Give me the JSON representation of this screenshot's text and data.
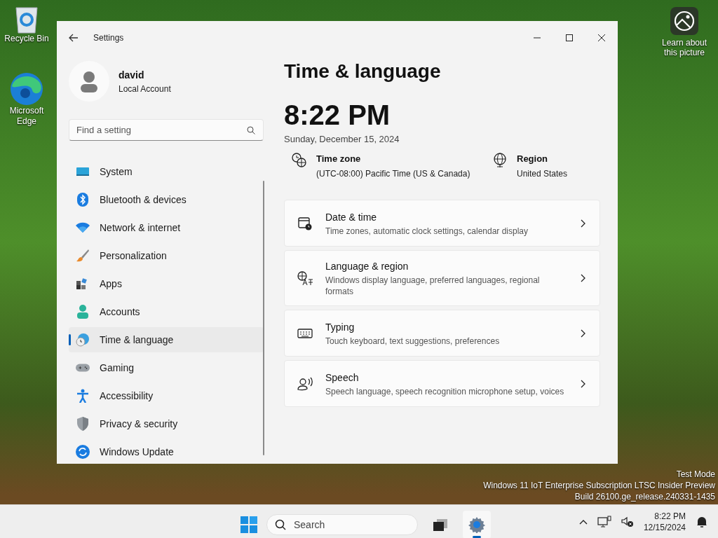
{
  "desktop": {
    "icons": [
      {
        "label": "Recycle Bin"
      },
      {
        "label": "Microsoft Edge"
      }
    ],
    "spotlight": {
      "label": "Learn about this picture"
    },
    "watermark": [
      "Test Mode",
      "Windows 11 IoT Enterprise Subscription LTSC Insider Preview",
      "Build 26100.ge_release.240331-1435"
    ]
  },
  "window": {
    "title": "Settings"
  },
  "user": {
    "name": "david",
    "account": "Local Account"
  },
  "search": {
    "placeholder": "Find a setting"
  },
  "sidebar": {
    "items": [
      {
        "label": "System",
        "selected": false
      },
      {
        "label": "Bluetooth & devices",
        "selected": false
      },
      {
        "label": "Network & internet",
        "selected": false
      },
      {
        "label": "Personalization",
        "selected": false
      },
      {
        "label": "Apps",
        "selected": false
      },
      {
        "label": "Accounts",
        "selected": false
      },
      {
        "label": "Time & language",
        "selected": true
      },
      {
        "label": "Gaming",
        "selected": false
      },
      {
        "label": "Accessibility",
        "selected": false
      },
      {
        "label": "Privacy & security",
        "selected": false
      },
      {
        "label": "Windows Update",
        "selected": false
      }
    ]
  },
  "page": {
    "title": "Time & language",
    "time": "8:22 PM",
    "date": "Sunday, December 15, 2024",
    "info": [
      {
        "title": "Time zone",
        "value": "(UTC-08:00) Pacific Time (US & Canada)"
      },
      {
        "title": "Region",
        "value": "United States"
      }
    ],
    "cards": [
      {
        "title": "Date & time",
        "description": "Time zones, automatic clock settings, calendar display"
      },
      {
        "title": "Language & region",
        "description": "Windows display language, preferred languages, regional formats"
      },
      {
        "title": "Typing",
        "description": "Touch keyboard, text suggestions, preferences"
      },
      {
        "title": "Speech",
        "description": "Speech language, speech recognition microphone setup, voices"
      }
    ]
  },
  "taskbar": {
    "search": {
      "placeholder": "Search"
    },
    "apps": [
      {
        "selected": false
      },
      {
        "selected": true
      }
    ],
    "time": "8:22 PM",
    "date": "12/15/2024"
  }
}
